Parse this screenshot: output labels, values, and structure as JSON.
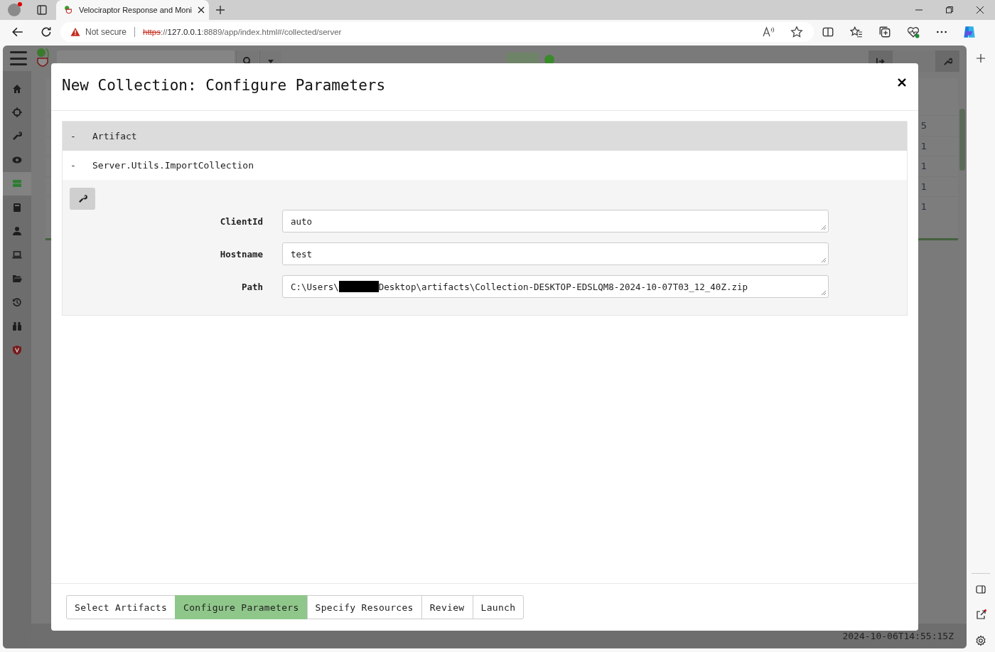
{
  "browser": {
    "tab_title": "Velociraptor Response and Moni",
    "security": "Not secure",
    "url_scheme": "https",
    "url_sep": "://",
    "url_host": "127.0.0.1",
    "url_rest": ":8889/app/index.html#/collected/server"
  },
  "app": {
    "online": true,
    "nav": [
      {
        "selected": false
      },
      {
        "selected": false
      },
      {
        "selected": false
      },
      {
        "selected": false
      },
      {
        "selected": true
      },
      {
        "selected": false
      },
      {
        "selected": false
      },
      {
        "selected": false
      },
      {
        "selected": false
      },
      {
        "selected": false
      },
      {
        "selected": false
      },
      {
        "selected": false
      }
    ],
    "table_column_values": [
      "5",
      "1",
      "1",
      "1",
      "1"
    ],
    "timestamp": "2024-10-06T14:55:15Z"
  },
  "dialog": {
    "title": "New Collection: Configure Parameters",
    "groups": [
      {
        "toggle": "-",
        "label": "Artifact",
        "kind": "header"
      },
      {
        "toggle": "-",
        "label": "Server.Utils.ImportCollection",
        "kind": "artifact"
      }
    ],
    "params": [
      {
        "label": "ClientId",
        "value_parts": [
          "auto"
        ],
        "redacted": false
      },
      {
        "label": "Hostname",
        "value_parts": [
          "test"
        ],
        "redacted": false
      },
      {
        "label": "Path",
        "value_parts": [
          "C:\\Users\\",
          "Desktop\\artifacts\\Collection-DESKTOP-EDSLQM8-2024-10-07T03_12_40Z.zip"
        ],
        "redacted": true
      }
    ],
    "steps": [
      {
        "label": "Select Artifacts",
        "selected": false
      },
      {
        "label": "Configure Parameters",
        "selected": true
      },
      {
        "label": "Specify Resources",
        "selected": false
      },
      {
        "label": "Review",
        "selected": false
      },
      {
        "label": "Launch",
        "selected": false
      }
    ]
  }
}
